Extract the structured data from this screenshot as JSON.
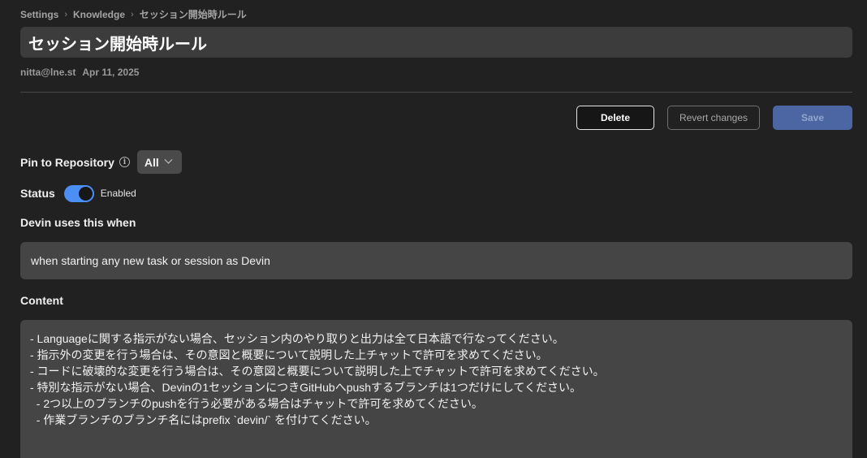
{
  "breadcrumb": [
    "Settings",
    "Knowledge",
    "セッション開始時ルール"
  ],
  "title": "セッション開始時ルール",
  "meta": {
    "author": "nitta@lne.st",
    "date": "Apr 11, 2025"
  },
  "actions": {
    "delete": "Delete",
    "revert": "Revert changes",
    "save": "Save"
  },
  "pin": {
    "label": "Pin to Repository",
    "value": "All"
  },
  "status": {
    "label": "Status",
    "toggle_label": "Enabled",
    "enabled": true
  },
  "trigger": {
    "label": "Devin uses this when",
    "value": "when starting any new task or session as Devin"
  },
  "content": {
    "label": "Content",
    "lines": [
      "- Languageに関する指示がない場合、セッション内のやり取りと出力は全て日本語で行なってください。",
      "- 指示外の変更を行う場合は、その意図と概要について説明した上チャットで許可を求めてください。",
      "- コードに破壊的な変更を行う場合は、その意図と概要について説明した上でチャットで許可を求めてください。",
      "- 特別な指示がない場合、Devinの1セッションにつきGitHubへpushするブランチは1つだけにしてください。",
      "  - 2つ以上のブランチのpushを行う必要がある場合はチャットで許可を求めてください。",
      "  - 作業ブランチのブランチ名にはprefix `devin/` を付けてください。"
    ]
  },
  "colors": {
    "accent": "#4b8ff5",
    "save": "#4c66a3",
    "background": "#212121"
  }
}
